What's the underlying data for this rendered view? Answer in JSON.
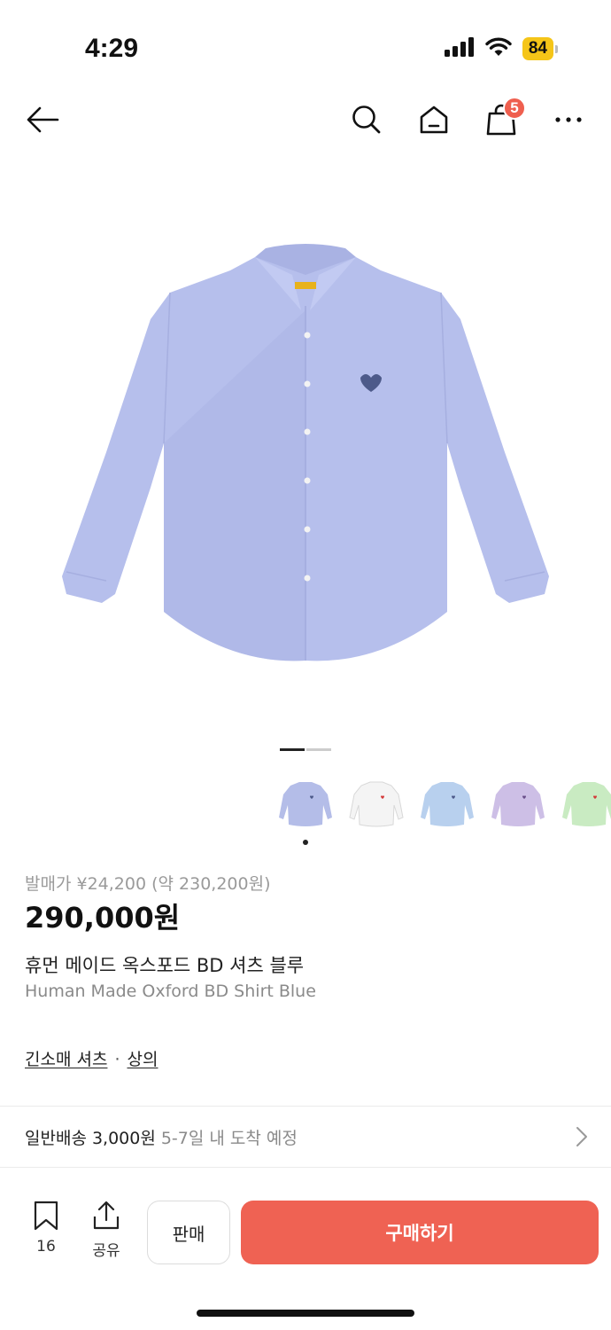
{
  "status_bar": {
    "time": "4:29",
    "battery": "84",
    "icons": [
      "signal-icon",
      "wifi-icon",
      "battery-icon"
    ]
  },
  "nav": {
    "icons": [
      "back-arrow-icon",
      "search-icon",
      "home-icon",
      "shopping-bag-icon",
      "more-icon"
    ],
    "cart_count": "5"
  },
  "product": {
    "image_subject": "light blue oxford button-down shirt",
    "carousel": {
      "total": 2,
      "active": 1
    },
    "thumbnails": [
      {
        "name": "thumb-blue",
        "color": "#b4bde8"
      },
      {
        "name": "thumb-white",
        "color": "#f4f4f4"
      },
      {
        "name": "thumb-light-blue",
        "color": "#b8d0ee"
      },
      {
        "name": "thumb-lavender",
        "color": "#cdbfe6"
      },
      {
        "name": "thumb-mint",
        "color": "#c9ebc2"
      }
    ],
    "release_price": "발매가 ¥24,200 (약 230,200원)",
    "price": "290,000원",
    "title_ko": "휴먼 메이드 옥스포드 BD 셔츠 블루",
    "title_en": "Human Made Oxford BD Shirt Blue"
  },
  "categories": {
    "primary": "긴소매 셔츠",
    "separator": "·",
    "secondary": "상의"
  },
  "shipping": {
    "method": "일반배송 3,000원",
    "eta": "5-7일 내 도착 예정"
  },
  "bottom_bar": {
    "bookmark_count": "16",
    "share_label": "공유",
    "sell_label": "판매",
    "buy_label": "구매하기"
  },
  "colors": {
    "accent": "#ef6253",
    "badge": "#ef5f4f",
    "battery": "#f5c518"
  }
}
